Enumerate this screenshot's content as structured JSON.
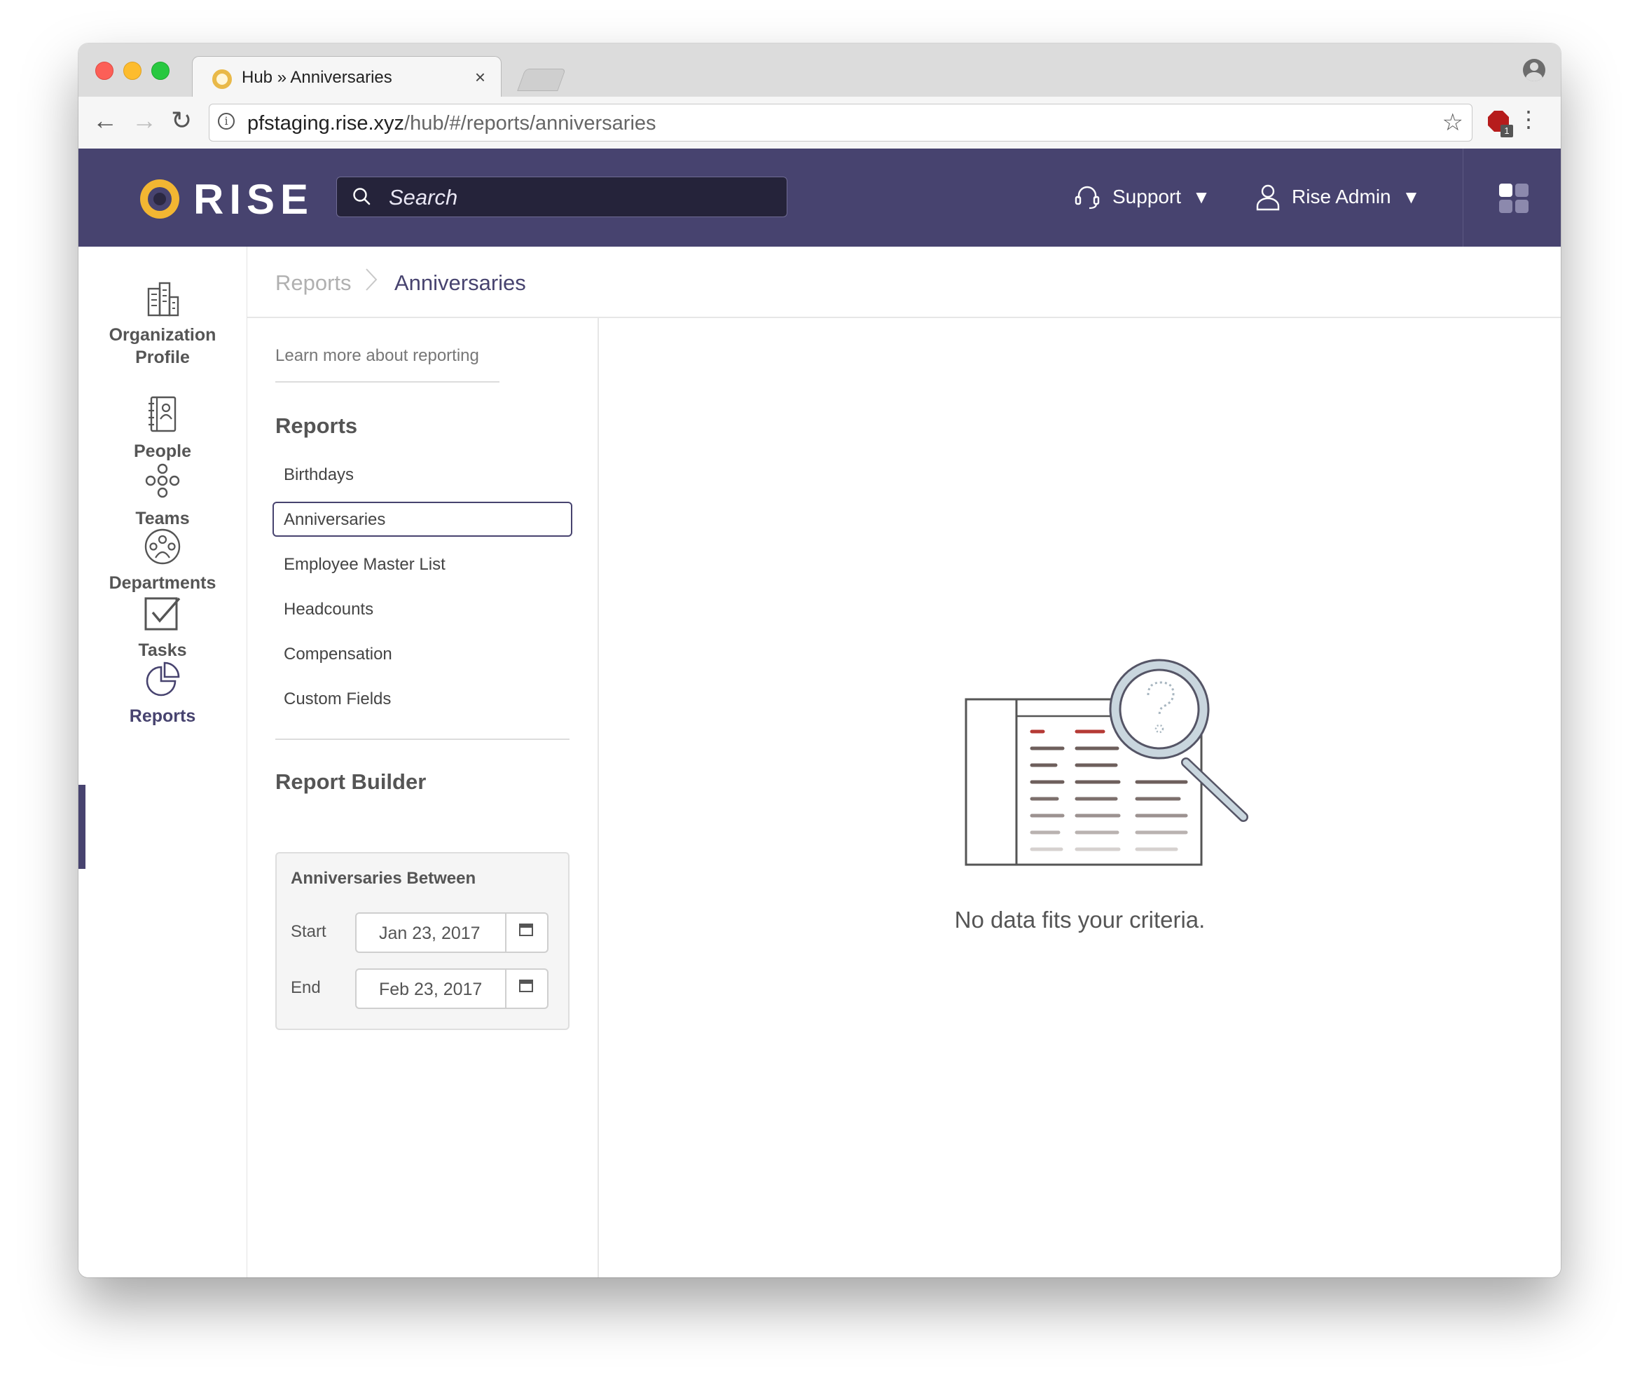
{
  "browser": {
    "tab_title": "Hub » Anniversaries",
    "tab_close": "×",
    "url_host": "pfstaging.rise.xyz",
    "url_path": "/hub/#/reports/anniversaries",
    "extension_badge": "1"
  },
  "header": {
    "logo_text": "RISE",
    "search_placeholder": "Search",
    "support_label": "Support",
    "user_label": "Rise Admin",
    "caret": "▼"
  },
  "leftnav": {
    "items": [
      {
        "label_line1": "Organization",
        "label_line2": "Profile",
        "icon": "building-icon"
      },
      {
        "label": "People",
        "icon": "address-book-icon"
      },
      {
        "label": "Teams",
        "icon": "teams-icon"
      },
      {
        "label": "Departments",
        "icon": "departments-icon"
      },
      {
        "label": "Tasks",
        "icon": "checkbox-icon"
      },
      {
        "label": "Reports",
        "icon": "pie-chart-icon",
        "active": true
      }
    ]
  },
  "breadcrumb": {
    "parent": "Reports",
    "current": "Anniversaries"
  },
  "subnav": {
    "learn_link": "Learn more about reporting",
    "reports_title": "Reports",
    "reports": [
      "Birthdays",
      "Anniversaries",
      "Employee Master List",
      "Headcounts",
      "Compensation",
      "Custom Fields"
    ],
    "selected_report": "Anniversaries",
    "builder_title": "Report Builder",
    "builder": {
      "section_title": "Anniversaries Between",
      "start_label": "Start",
      "start_value": "Jan 23, 2017",
      "end_label": "End",
      "end_value": "Feb 23, 2017"
    }
  },
  "main": {
    "empty_message": "No data fits your criteria."
  },
  "colors": {
    "brand": "#47436f",
    "logo_accent": "#f2b632",
    "illustration_red": "#b53a35"
  }
}
